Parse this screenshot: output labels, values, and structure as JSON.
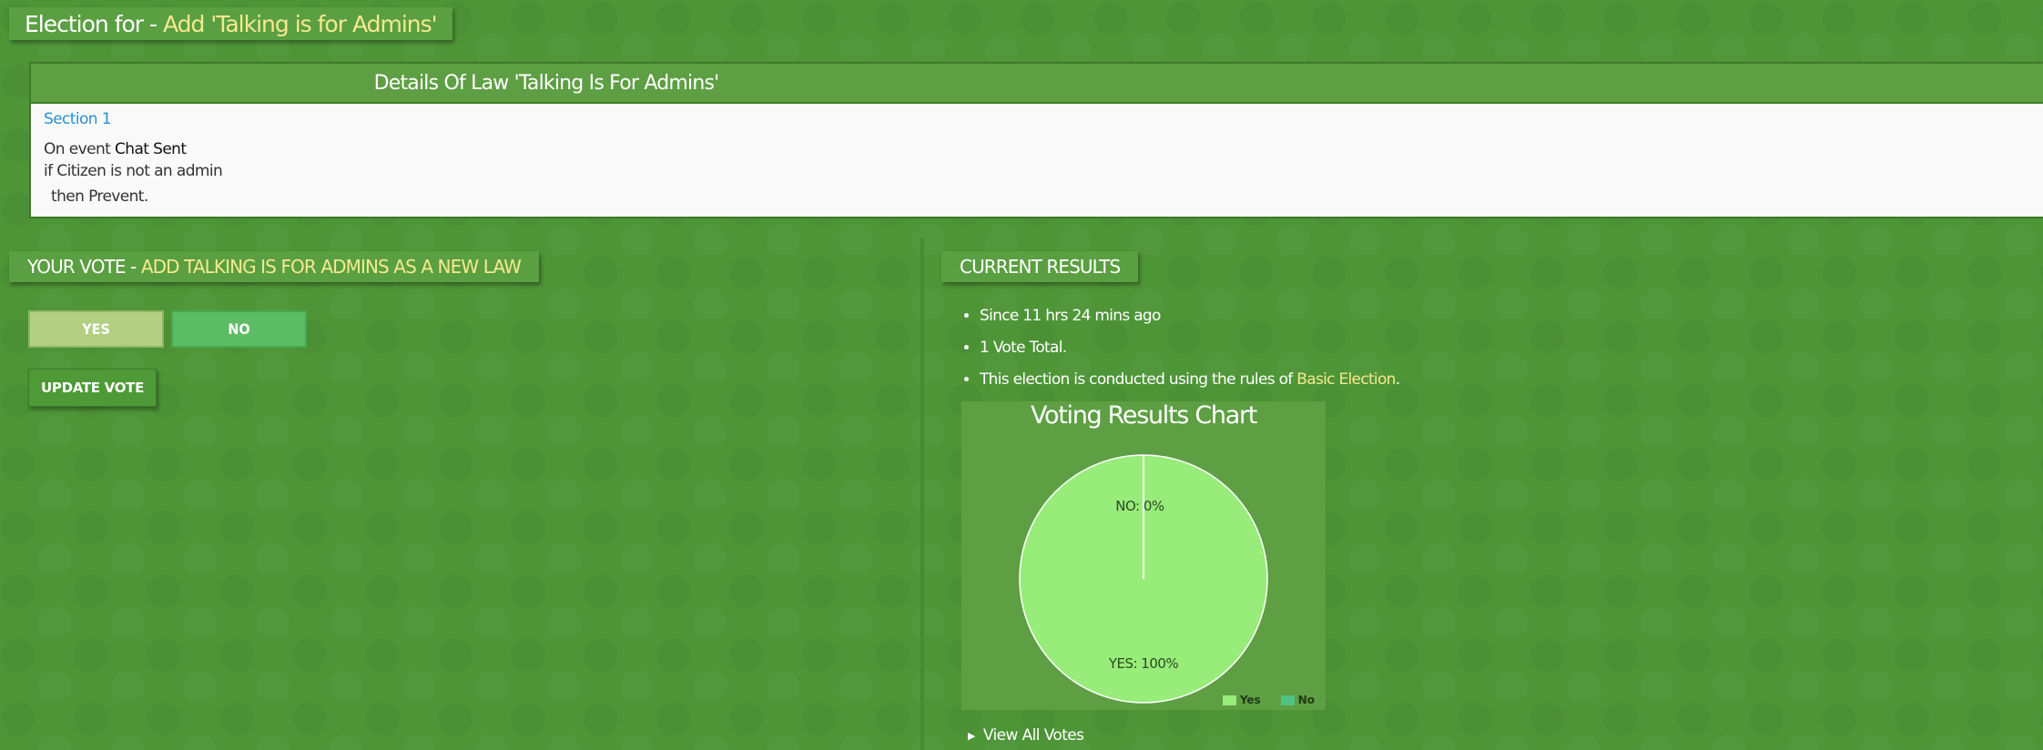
{
  "page_title": {
    "prefix": "Election for -",
    "highlight": "Add 'Talking is for Admins'"
  },
  "law": {
    "header": "Details Of Law 'Talking Is For Admins'",
    "section_link": "Section 1",
    "event_prefix": "On event",
    "event_name": "Chat Sent",
    "condition": "if Citizen is not an admin",
    "action": "then Prevent."
  },
  "vote": {
    "tab_prefix": "YOUR VOTE -",
    "tab_highlight": "ADD TALKING IS FOR ADMINS AS A NEW LAW",
    "yes_label": "YES",
    "no_label": "NO",
    "selected": "YES",
    "update_label": "UPDATE VOTE"
  },
  "results": {
    "tab_label": "CURRENT RESULTS",
    "since": "Since 11 hrs 24 mins ago",
    "total": "1 Vote Total.",
    "rules_prefix": "This election is conducted using the rules of",
    "rules_link": "Basic Election",
    "rules_suffix": ".",
    "view_all_label": "View All Votes"
  },
  "chart_data": {
    "type": "pie",
    "title": "Voting Results Chart",
    "categories": [
      "Yes",
      "No"
    ],
    "values": [
      100,
      0
    ],
    "slice_labels": [
      "YES: 100%",
      "NO: 0%"
    ],
    "colors": [
      "#98ec7a",
      "#4fc482"
    ],
    "legend_position": "bottom-right"
  },
  "colors": {
    "background": "#4e9537",
    "panel": "#5a9f41",
    "accent": "#f6e98f",
    "link": "#2a8fd0"
  }
}
